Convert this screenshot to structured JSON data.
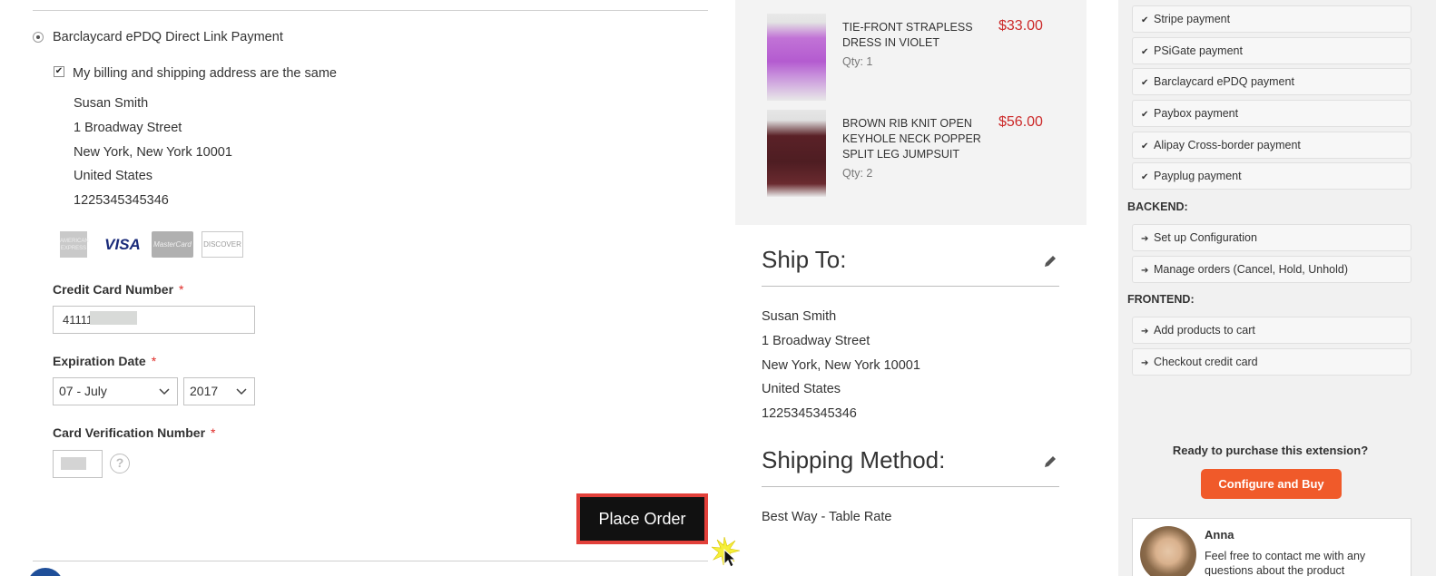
{
  "payment": {
    "method_title": "Barclaycard ePDQ Direct Link Payment",
    "same_address_label": "My billing and shipping address are the same",
    "address": {
      "name": "Susan Smith",
      "street": "1 Broadway Street",
      "city_line": "New York, New York 10001",
      "country": "United States",
      "phone": "1225345345346"
    },
    "card_brands": [
      "AMERICAN EXPRESS",
      "VISA",
      "MasterCard",
      "DISCOVER"
    ],
    "cc_number_label": "Credit Card Number",
    "cc_number_value": "41111",
    "expiration_label": "Expiration Date",
    "exp_month": "07 - July",
    "exp_year": "2017",
    "cvv_label": "Card Verification Number",
    "required_mark": "*",
    "help_glyph": "?",
    "place_order_label": "Place Order"
  },
  "summary": {
    "items": [
      {
        "name": "TIE-FRONT STRAPLESS DRESS IN VIOLET",
        "qty": "Qty: 1",
        "price": "$33.00"
      },
      {
        "name": "BROWN RIB KNIT OPEN KEYHOLE NECK POPPER SPLIT LEG JUMPSUIT",
        "qty": "Qty: 2",
        "price": "$56.00"
      }
    ],
    "ship_to_title": "Ship To:",
    "ship_to": {
      "name": "Susan Smith",
      "street": "1 Broadway Street",
      "city_line": "New York, New York 10001",
      "country": "United States",
      "phone": "1225345345346"
    },
    "shipping_method_title": "Shipping Method:",
    "shipping_method": "Best Way - Table Rate"
  },
  "sidebar": {
    "payment_items": [
      "Stripe payment",
      "PSiGate payment",
      "Barclaycard ePDQ payment",
      "Paybox payment",
      "Alipay Cross-border payment",
      "Payplug payment"
    ],
    "backend_heading": "BACKEND:",
    "backend_items": [
      "Set up Configuration",
      "Manage orders (Cancel, Hold, Unhold)"
    ],
    "frontend_heading": "FRONTEND:",
    "frontend_items": [
      "Add products to cart",
      "Checkout credit card"
    ],
    "ready_text": "Ready to purchase this extension?",
    "buy_label": "Configure and Buy",
    "contact_name": "Anna",
    "contact_text": "Feel free to contact me with any questions about the product"
  },
  "colors": {
    "price": "#cc2a2a",
    "buy_button": "#f05a2a",
    "place_order_highlight": "#e2403a",
    "required": "#e02b27"
  }
}
